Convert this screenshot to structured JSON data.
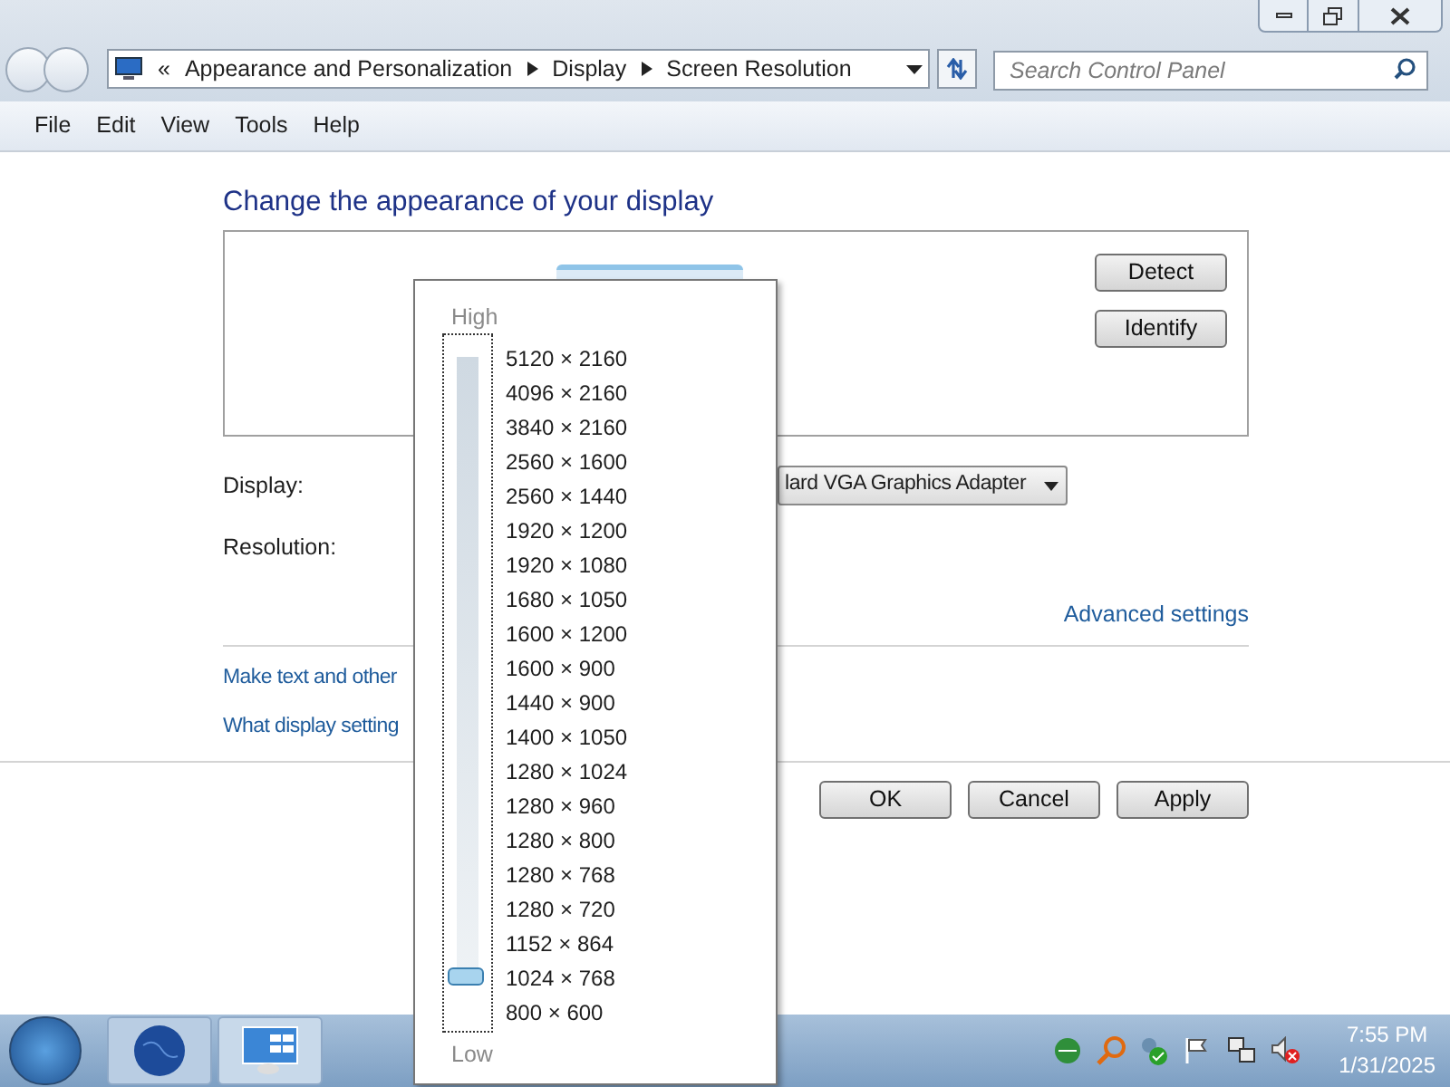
{
  "address_bar": {
    "prefix": "«",
    "crumbs": [
      "Appearance and Personalization",
      "Display",
      "Screen Resolution"
    ]
  },
  "search": {
    "placeholder": "Search Control Panel"
  },
  "menu": [
    "File",
    "Edit",
    "View",
    "Tools",
    "Help"
  ],
  "heading": "Change the appearance of your display",
  "monitor_buttons": [
    "Detect",
    "Identify"
  ],
  "display": {
    "label": "Display:",
    "value": "lard VGA Graphics Adapter"
  },
  "resolution": {
    "label": "Resolution:"
  },
  "advanced_link": "Advanced settings",
  "links": [
    "Make text and other",
    "What display setting"
  ],
  "buttons": [
    "OK",
    "Cancel",
    "Apply"
  ],
  "resolution_popup": {
    "high": "High",
    "low": "Low",
    "level": 0.056,
    "options": [
      "5120 × 2160",
      "4096 × 2160",
      "3840 × 2160",
      "2560 × 1600",
      "2560 × 1440",
      "1920 × 1200",
      "1920 × 1080",
      "1680 × 1050",
      "1600 × 1200",
      "1600 × 900",
      "1440 × 900",
      "1400 × 1050",
      "1280 × 1024",
      "1280 × 960",
      "1280 × 800",
      "1280 × 768",
      "1280 × 720",
      "1152 × 864",
      "1024 × 768",
      "800 × 600"
    ]
  },
  "clock": {
    "time": "7:55 PM",
    "date": "1/31/2025"
  }
}
